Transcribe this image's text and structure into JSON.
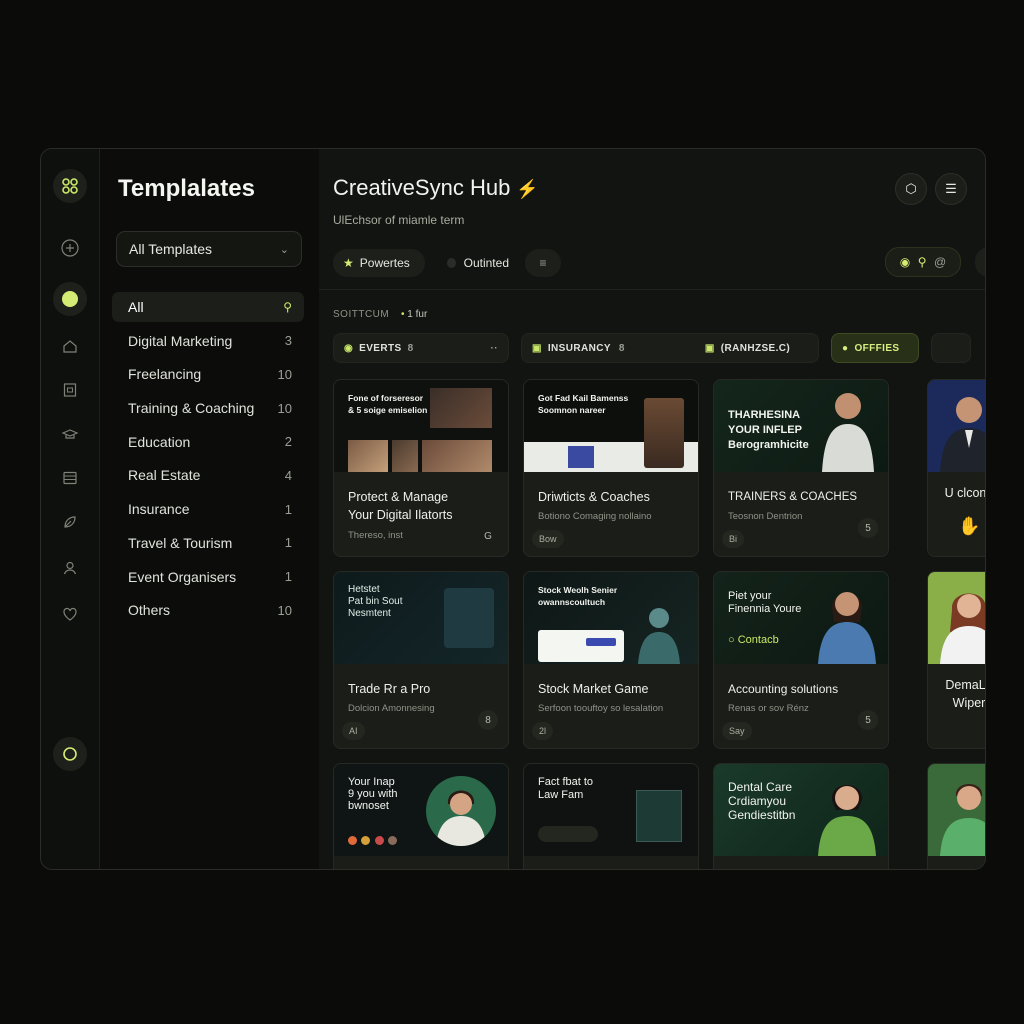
{
  "sidebar": {
    "title": "Templalates",
    "filter": "All Templates",
    "categories": [
      {
        "label": "All",
        "count": ""
      },
      {
        "label": "Digital Marketing",
        "count": "3"
      },
      {
        "label": "Freelancing",
        "count": "10"
      },
      {
        "label": "Training & Coaching",
        "count": "10"
      },
      {
        "label": "Education",
        "count": "2"
      },
      {
        "label": "Real Estate",
        "count": "4"
      },
      {
        "label": "Insurance",
        "count": "1"
      },
      {
        "label": "Travel & Tourism",
        "count": "1"
      },
      {
        "label": "Event Organisers",
        "count": "1"
      },
      {
        "label": "Others",
        "count": "10"
      }
    ]
  },
  "header": {
    "title": "CreativeSync Hub",
    "subtitle": "UlEchsor of miamle term",
    "pill_powertes": "Powertes",
    "pill_outinted": "Outinted"
  },
  "sort": {
    "label": "SOITTCUM",
    "value": "1 fur"
  },
  "chips": {
    "events": "EVERTS",
    "events_num": "8",
    "insurancy": "INSURANCY",
    "insurancy_num": "8",
    "ranhzse": "(RANHZSE.C)",
    "offfies": "OFFFIES"
  },
  "cards": [
    {
      "thumb": "Fone of forseresor\n& 5 soige emiselion",
      "title": "Protect & Manage\nYour Digital Ilatorts",
      "meta": "Thereso, inst",
      "tag": "",
      "badge": "G"
    },
    {
      "thumb": "Got Fad Kail Bamenss\nSoomnon nareer",
      "title": "Driwticts & Coaches",
      "meta": "Botiono Comaging nollaino",
      "tag": "Bow",
      "badge": ""
    },
    {
      "thumb": "THARHESINA\nYOUR INFLEP\nBerogramhicite",
      "title": "TRAINERS & COACHES",
      "meta": "Teosnon Dentrion",
      "tag": "Bi",
      "badge": "5"
    },
    {
      "thumb": "",
      "title": "U clcone",
      "meta": "",
      "tag": "",
      "badge": ""
    },
    {
      "thumb": "Hetstet\nPat bin Sout\nNesmtent",
      "title": "Trade Rr a Pro",
      "meta": "Dolcion Amonnesing",
      "tag": "AI",
      "badge": "8"
    },
    {
      "thumb": "Stock Weolh Senier\nowannscoultuch",
      "title": "Stock Market Game",
      "meta": "Serfoon toouftoy so lesalation",
      "tag": "2l",
      "badge": ""
    },
    {
      "thumb": "Piet your\nFinennia Youre",
      "title": "Accounting solutions",
      "meta": "Renas or sov Rénz",
      "tag": "Say",
      "badge": "5"
    },
    {
      "thumb": "",
      "title": "DemaLe\nWiper",
      "meta": "",
      "tag": "",
      "badge": ""
    },
    {
      "thumb": "Your Inap\n9 you with\nbwnoset",
      "title": "",
      "meta": "",
      "tag": "",
      "badge": ""
    },
    {
      "thumb": "Fact fbat to\nLaw Fam",
      "title": "",
      "meta": "",
      "tag": "",
      "badge": ""
    },
    {
      "thumb": "Dental Care\nCrdiamyou\nGendiestitbn",
      "title": "",
      "meta": "",
      "tag": "",
      "badge": ""
    },
    {
      "thumb": "",
      "title": "",
      "meta": "",
      "tag": "",
      "badge": ""
    }
  ],
  "contact_label": "Contacb",
  "colors": {
    "accent": "#c9e86a",
    "bg": "#111310"
  }
}
